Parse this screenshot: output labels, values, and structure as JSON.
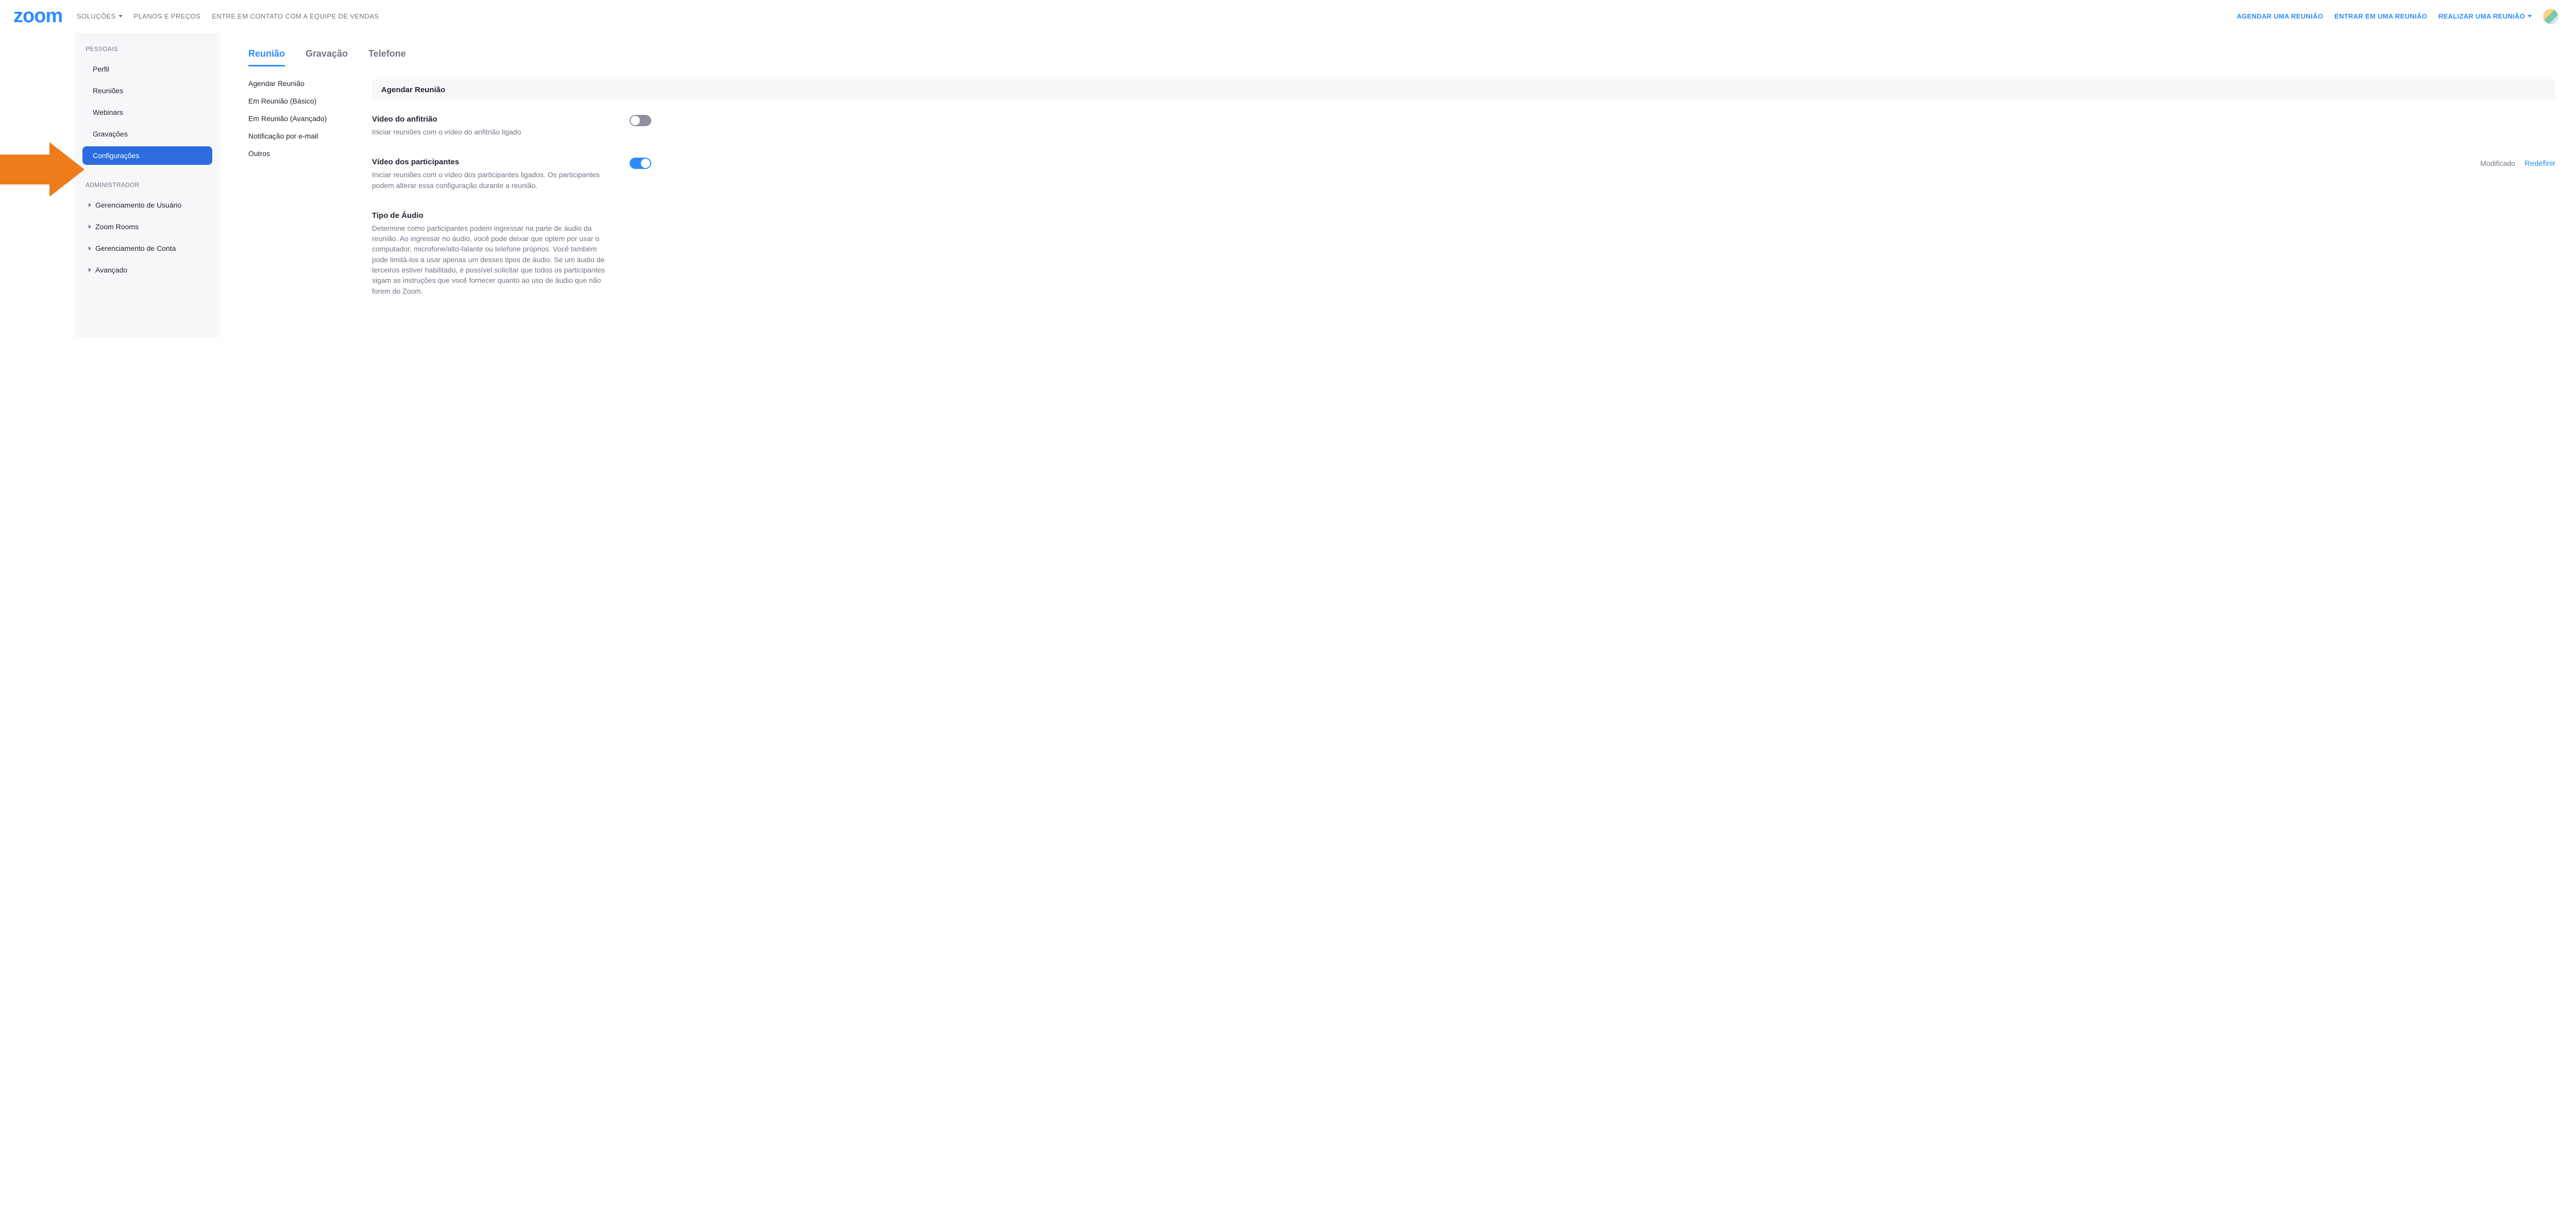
{
  "topnav": {
    "logo": "zoom",
    "left": [
      {
        "label": "SOLUÇÕES",
        "dropdown": true
      },
      {
        "label": "PLANOS E PREÇOS",
        "dropdown": false
      },
      {
        "label": "ENTRE EM CONTATO COM A EQUIPE DE VENDAS",
        "dropdown": false
      }
    ],
    "right": [
      {
        "label": "AGENDAR UMA REUNIÃO",
        "dropdown": false
      },
      {
        "label": "ENTRAR EM UMA REUNIÃO",
        "dropdown": false
      },
      {
        "label": "REALIZAR UMA REUNIÃO",
        "dropdown": true
      }
    ]
  },
  "sidebar": {
    "section1_label": "PESSOAIS",
    "section1_items": [
      {
        "label": "Perfil"
      },
      {
        "label": "Reuniões"
      },
      {
        "label": "Webinars"
      },
      {
        "label": "Gravações"
      },
      {
        "label": "Configurações",
        "active": true
      }
    ],
    "section2_label": "ADMINISTRADOR",
    "section2_items": [
      {
        "label": "Gerenciamento de Usuário"
      },
      {
        "label": "Zoom Rooms"
      },
      {
        "label": "Gerenciamento de Conta"
      },
      {
        "label": "Avançado"
      }
    ]
  },
  "tabs": [
    {
      "label": "Reunião",
      "active": true
    },
    {
      "label": "Gravação"
    },
    {
      "label": "Telefone"
    }
  ],
  "subnav": [
    "Agendar Reunião",
    "Em Reunião (Básico)",
    "Em Reunião (Avançado)",
    "Notificação por e-mail",
    "Outros"
  ],
  "section_heading": "Agendar Reunião",
  "settings": [
    {
      "title": "Vídeo do anfitrião",
      "desc": "Iniciar reuniões com o vídeo do anfitrião ligado",
      "on": false,
      "modified": false
    },
    {
      "title": "Vídeo dos participantes",
      "desc": "Iniciar reuniões com o vídeo dos participantes ligados. Os participantes podem alterar essa configuração durante a reunião.",
      "on": true,
      "modified": true
    },
    {
      "title": "Tipo de Áudio",
      "desc": "Determine como participantes podem ingressar na parte de áudio da reunião. Ao ingressar no áudio, você pode deixar que optem por usar o computador, microfone/alto-falante ou telefone próprios. Você também pode limitá-los a usar apenas um desses tipos de áudio. Se um áudio de terceiros estiver habilitado, é possível solicitar que todos os participantes sigam as instruções que você fornecer quanto ao uso de áudio que não forem do Zoom.",
      "on": null,
      "modified": false
    }
  ],
  "labels": {
    "modified": "Modificado",
    "reset": "Redefinir"
  },
  "colors": {
    "accent": "#2d8cff",
    "sidebar_active": "#2d6cdf",
    "pointer": "#ef7c1a"
  }
}
